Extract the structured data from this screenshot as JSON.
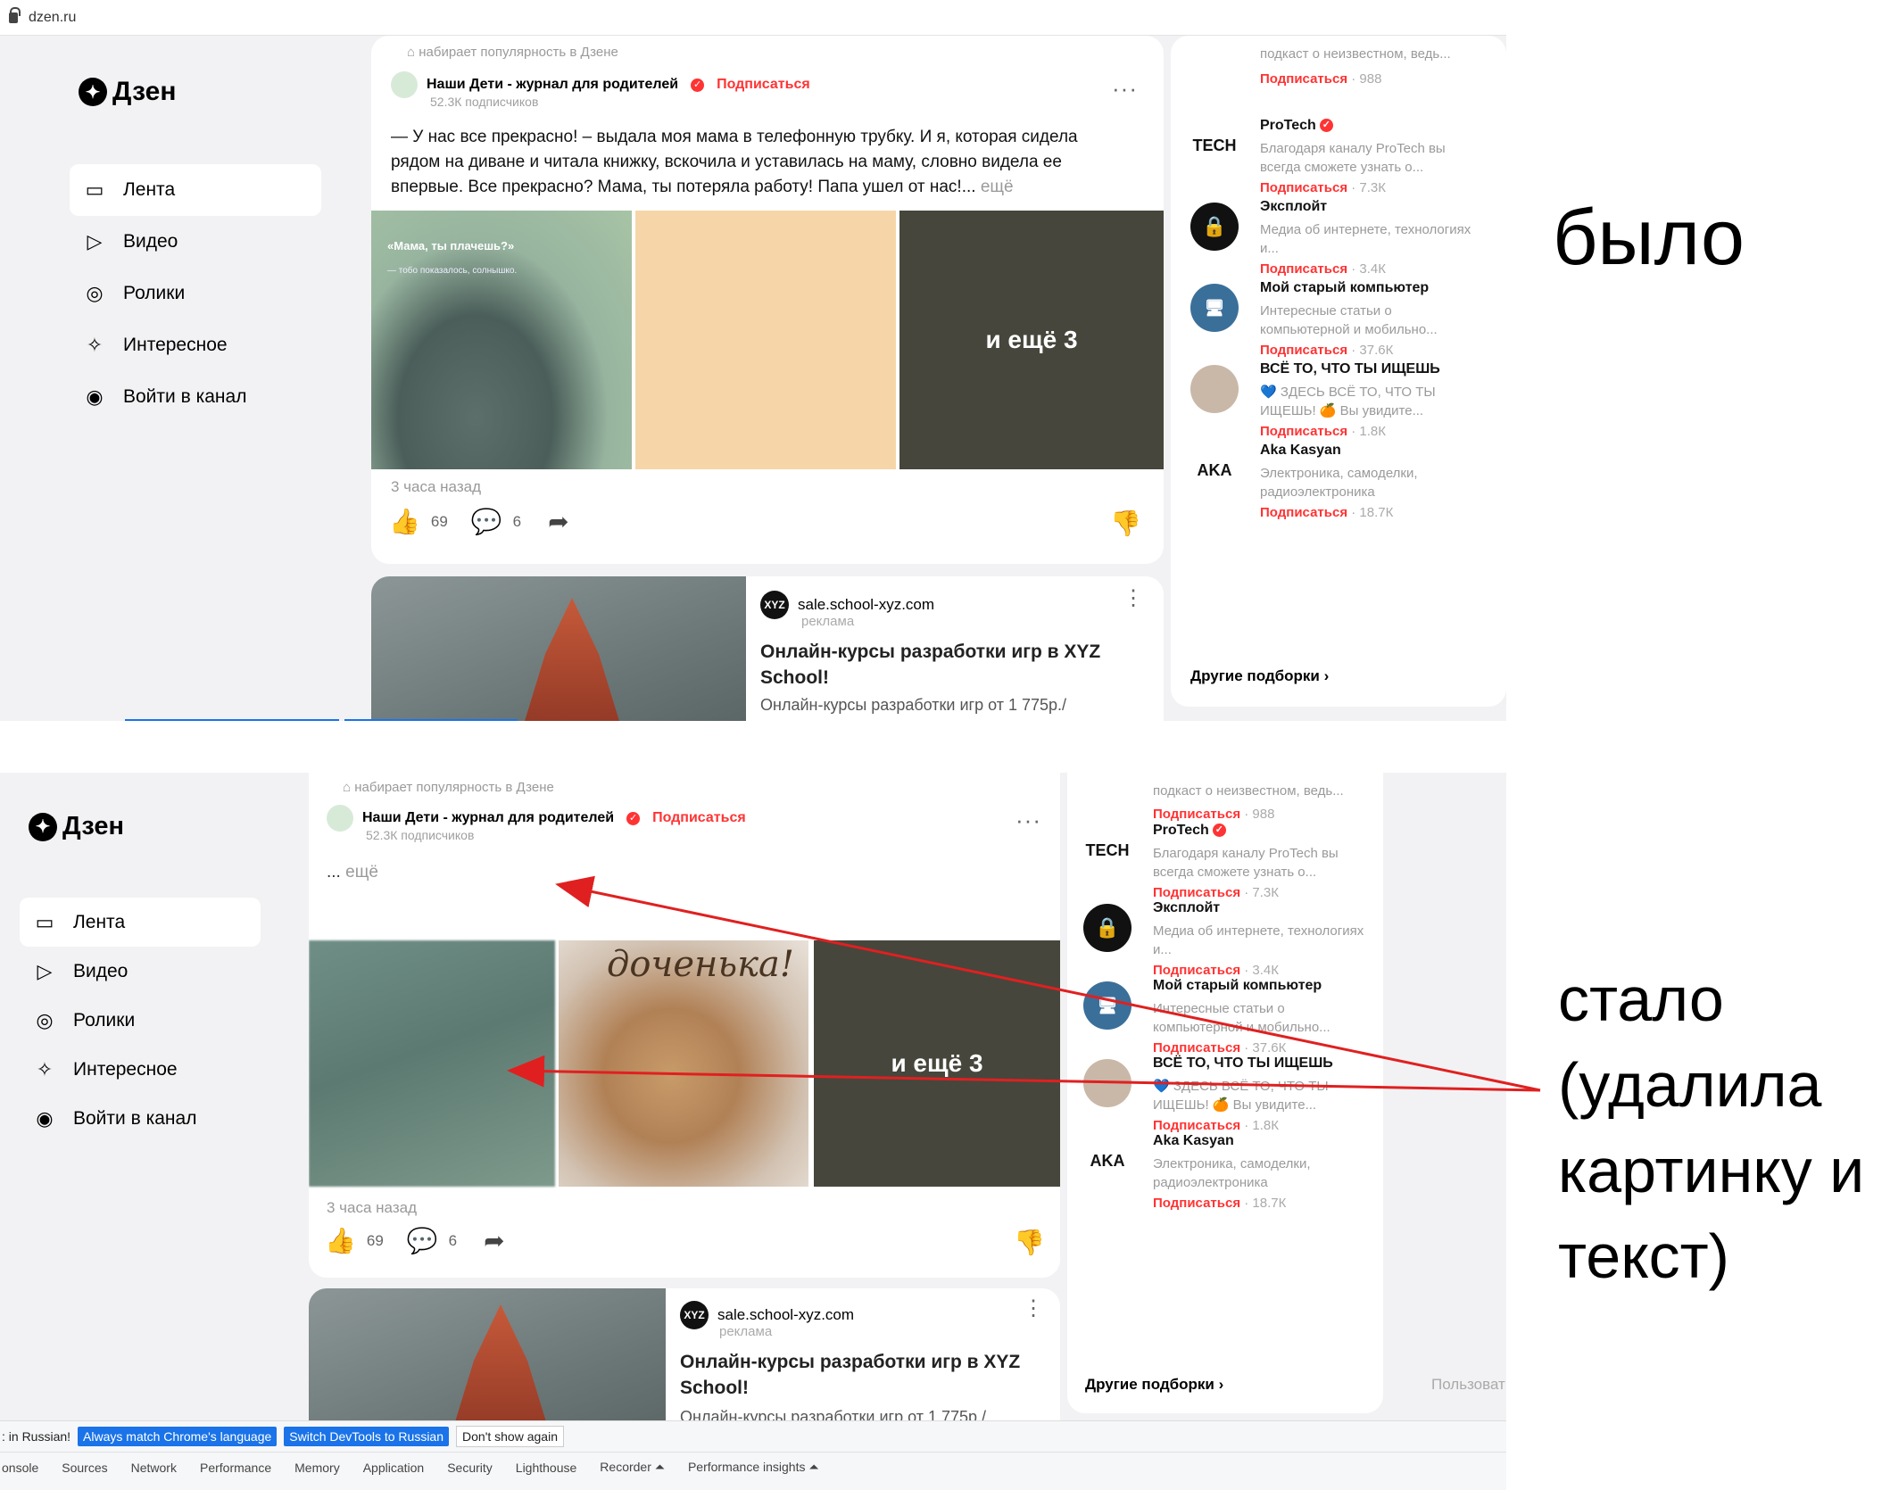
{
  "browser": {
    "url": "dzen.ru"
  },
  "logo": "Дзен",
  "nav": [
    {
      "label": "Лента",
      "icon": "feed-icon"
    },
    {
      "label": "Видео",
      "icon": "play-icon"
    },
    {
      "label": "Ролики",
      "icon": "shorts-icon"
    },
    {
      "label": "Интересное",
      "icon": "star-icon"
    },
    {
      "label": "Войти в канал",
      "icon": "profile-icon"
    }
  ],
  "post": {
    "trending": "набирает популярность в Дзене",
    "channel": "Наши Дети - журнал для родителей",
    "subscribe": "Подписаться",
    "subscribers": "52.3К подписчиков",
    "text_before": "— У нас все прекрасно! – выдала моя мама в телефонную трубку. И я, которая сидела рядом на диване и читала книжку, вскочила и уставилась на маму, словно видела ее впервые. Все прекрасно? Мама, ты потеряла работу! Папа ушел от нас!...",
    "text_after": "...",
    "more": "ещё",
    "image1_title": "«Мама, ты плачешь?»",
    "image1_sub": "— тобо показалось, солнышко.",
    "image_more_label": "и ещё 3",
    "image_bear_caption": "доченька!",
    "time": "3 часа назад",
    "likes": "69",
    "comments": "6"
  },
  "ad": {
    "domain": "sale.school-xyz.com",
    "label": "реклама",
    "logo": "XYZ",
    "title": "Онлайн-курсы разработки игр в XYZ School!",
    "desc": "Онлайн-курсы разработки игр от 1 775р./"
  },
  "sidebar": {
    "top_desc": "подкаст о неизвестном, ведь...",
    "top_sub": "Подписаться",
    "top_count": "· 988",
    "items": [
      {
        "name": "ProTech",
        "desc": "Благодаря каналу ProTech вы всегда сможете узнать о...",
        "sub": "Подписаться",
        "count": "· 7.3К",
        "avatar": "TECH",
        "avatar_icon": "protech-logo-icon",
        "verified": true
      },
      {
        "name": "Эксплойт",
        "desc": "Медиа об интернете, технологиях и...",
        "sub": "Подписаться",
        "count": "· 3.4К",
        "avatar": "🔒",
        "avatar_icon": "lock-icon",
        "verified": false
      },
      {
        "name": "Мой старый компьютер",
        "desc": "Интересные статьи о компьютерной и мобильно...",
        "sub": "Подписаться",
        "count": "· 37.6К",
        "avatar": "🖥",
        "avatar_icon": "computer-icon",
        "verified": false
      },
      {
        "name": "ВСЁ ТО, ЧТО ТЫ ИЩЕШЬ",
        "desc": "💙 ЗДЕСЬ ВСЁ ТО, ЧТО ТЫ ИЩЕШЬ! 🍊 Вы увидите...",
        "sub": "Подписаться",
        "count": "· 1.8К",
        "avatar": "",
        "avatar_icon": "portrait-icon",
        "verified": false
      },
      {
        "name": "Aka Kasyan",
        "desc": "Электроника, самоделки, радиоэлектроника",
        "sub": "Подписаться",
        "count": "· 18.7К",
        "avatar": "AKA",
        "avatar_icon": "aka-logo-icon",
        "verified": false
      }
    ],
    "other": "Другие подборки ›"
  },
  "labels": {
    "before": "было",
    "after": "стало (удалила картинку и текст)"
  },
  "bottom_extra": "Пользоват",
  "devtools": {
    "banner_text": ": in Russian!",
    "btn_match": "Always match Chrome's language",
    "btn_switch": "Switch DevTools to Russian",
    "btn_dismiss": "Don't show again",
    "tabs": [
      "onsole",
      "Sources",
      "Network",
      "Performance",
      "Memory",
      "Application",
      "Security",
      "Lighthouse",
      "Recorder ⏶",
      "Performance insights ⏶"
    ]
  },
  "colors": {
    "accent": "#ff3333",
    "link_blue": "#1a73e8",
    "arrow": "#e02020"
  }
}
